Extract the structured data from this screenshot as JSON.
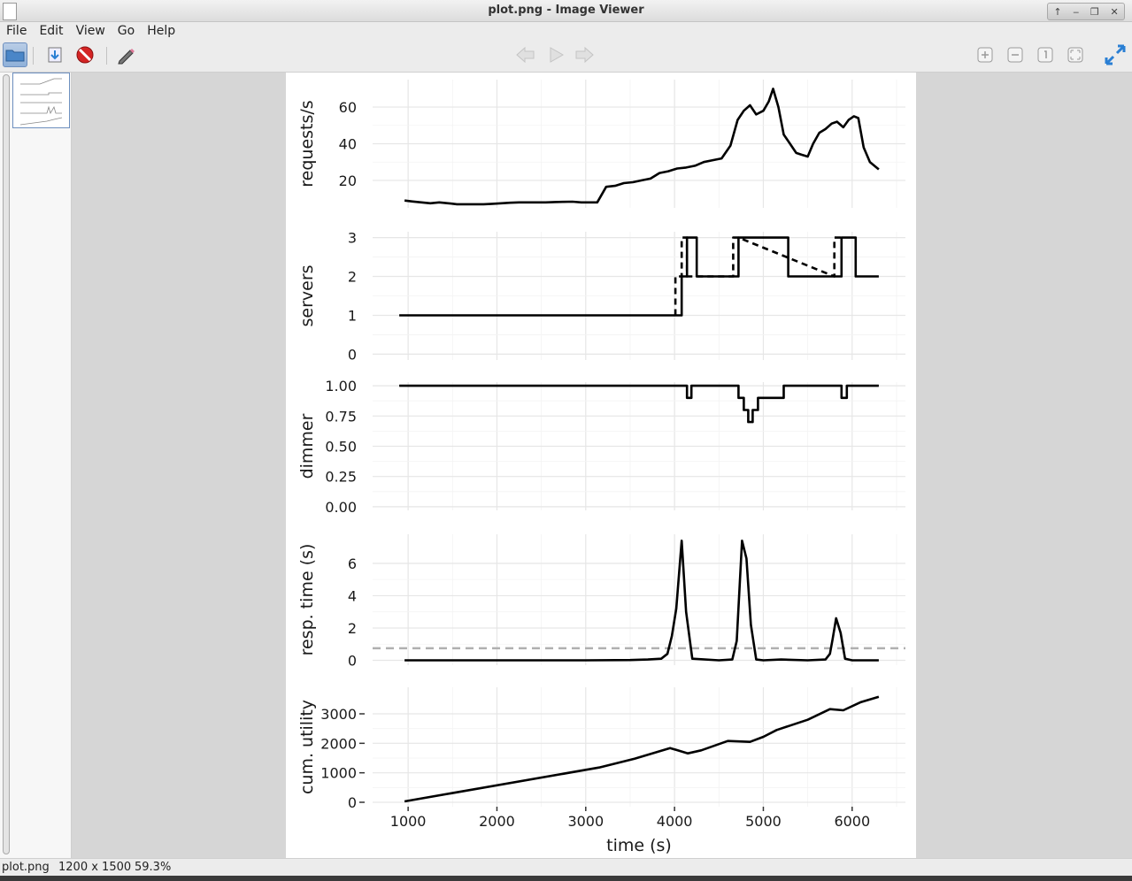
{
  "window": {
    "title": "plot.png - Image Viewer"
  },
  "menu": [
    "File",
    "Edit",
    "View",
    "Go",
    "Help"
  ],
  "status": {
    "filename": "plot.png",
    "dimensions": "1200 x 1500",
    "zoom": "59.3%"
  },
  "chart_data": [
    {
      "type": "line",
      "ylabel": "requests/s",
      "xlim": [
        600,
        6600
      ],
      "ylim": [
        5,
        75
      ],
      "yticks": [
        20,
        40,
        60
      ],
      "yticklabels": [
        "20",
        "40",
        "60"
      ],
      "series": [
        {
          "dash": false,
          "step": false,
          "x": [
            960,
            1050,
            1150,
            1250,
            1350,
            1450,
            1550,
            1650,
            1750,
            1850,
            1950,
            2050,
            2150,
            2250,
            2350,
            2450,
            2550,
            2650,
            2750,
            2850,
            2950,
            3050,
            3130,
            3230,
            3330,
            3430,
            3530,
            3630,
            3730,
            3830,
            3930,
            4030,
            4130,
            4230,
            4330,
            4430,
            4530,
            4630,
            4710,
            4780,
            4850,
            4920,
            5000,
            5060,
            5110,
            5170,
            5230,
            5300,
            5370,
            5430,
            5500,
            5560,
            5630,
            5700,
            5770,
            5830,
            5900,
            5960,
            6020,
            6070,
            6130,
            6200,
            6300
          ],
          "y": [
            9,
            8.5,
            8,
            7.5,
            8,
            7.5,
            7,
            7,
            7,
            7,
            7.2,
            7.5,
            7.8,
            8,
            8,
            8,
            8,
            8.2,
            8.3,
            8.4,
            8,
            8,
            8,
            16.5,
            17,
            18.5,
            19,
            20,
            21,
            24,
            25,
            26.5,
            27,
            28,
            30,
            31,
            32,
            39,
            53,
            58,
            61,
            56,
            58,
            63,
            70,
            60,
            45,
            40,
            35,
            34,
            33,
            40,
            46,
            48,
            51,
            52,
            49,
            53,
            55,
            54,
            38,
            30,
            26
          ]
        }
      ]
    },
    {
      "type": "line",
      "ylabel": "servers",
      "xlim": [
        600,
        6600
      ],
      "ylim": [
        -0.15,
        3.15
      ],
      "yticks": [
        0,
        1,
        2,
        3
      ],
      "yticklabels": [
        "0",
        "1",
        "2",
        "3"
      ],
      "series": [
        {
          "dash": false,
          "step": true,
          "x": [
            900,
            4080,
            4080,
            4140,
            4140,
            4250,
            4250,
            4720,
            4720,
            5280,
            5280,
            5880,
            5880,
            6040,
            6040,
            6300
          ],
          "y": [
            1,
            1,
            2,
            2,
            3,
            3,
            2,
            2,
            3,
            3,
            2,
            2,
            3,
            3,
            2,
            2
          ]
        },
        {
          "dash": true,
          "step": true,
          "x": [
            4010,
            4010,
            4080,
            4080,
            4140,
            4140,
            4250,
            4660,
            4660,
            4720,
            5800,
            5800,
            5880
          ],
          "y": [
            1,
            2,
            2,
            3,
            3,
            2,
            2,
            2,
            3,
            3,
            2,
            3,
            3
          ]
        }
      ]
    },
    {
      "type": "line",
      "ylabel": "dimmer",
      "xlim": [
        600,
        6600
      ],
      "ylim": [
        -0.03,
        1.03
      ],
      "yticks": [
        0,
        0.25,
        0.5,
        0.75,
        1
      ],
      "yticklabels": [
        "0.00",
        "0.25",
        "0.50",
        "0.75",
        "1.00"
      ],
      "series": [
        {
          "dash": false,
          "step": true,
          "x": [
            900,
            4140,
            4140,
            4190,
            4190,
            4720,
            4720,
            4780,
            4780,
            4830,
            4830,
            4880,
            4880,
            4940,
            4940,
            5000,
            5000,
            5230,
            5230,
            5880,
            5880,
            5940,
            5940,
            6300
          ],
          "y": [
            1,
            1,
            0.9,
            0.9,
            1,
            1,
            0.9,
            0.9,
            0.8,
            0.8,
            0.7,
            0.7,
            0.8,
            0.8,
            0.9,
            0.9,
            0.9,
            0.9,
            1,
            1,
            0.9,
            0.9,
            1,
            1
          ]
        }
      ]
    },
    {
      "type": "line",
      "ylabel": "resp. time (s)",
      "xlim": [
        600,
        6600
      ],
      "ylim": [
        -0.3,
        7.8
      ],
      "yticks": [
        0,
        2,
        4,
        6
      ],
      "yticklabels": [
        "0",
        "2",
        "4",
        "6"
      ],
      "reference_line": {
        "y": 0.75,
        "color": "#b0b0b0"
      },
      "series": [
        {
          "dash": false,
          "step": false,
          "x": [
            960,
            1500,
            2000,
            2500,
            3000,
            3500,
            3700,
            3850,
            3920,
            3970,
            4020,
            4080,
            4130,
            4200,
            4500,
            4650,
            4700,
            4760,
            4810,
            4860,
            4920,
            5000,
            5200,
            5500,
            5700,
            5750,
            5780,
            5820,
            5870,
            5920,
            6000,
            6300
          ],
          "y": [
            0,
            0,
            0,
            0,
            0,
            0.02,
            0.05,
            0.1,
            0.4,
            1.5,
            3.2,
            7.4,
            3,
            0.1,
            0,
            0.05,
            1.2,
            7.4,
            6.3,
            2.2,
            0.05,
            0,
            0.05,
            0,
            0.05,
            0.4,
            1.3,
            2.6,
            1.7,
            0.1,
            0,
            0
          ]
        }
      ]
    },
    {
      "type": "line",
      "ylabel": "cum. utility",
      "xlabel": "time (s)",
      "xlim": [
        600,
        6600
      ],
      "ylim": [
        -150,
        3900
      ],
      "yticks": [
        0,
        1000,
        2000,
        3000
      ],
      "yticklabels": [
        "0",
        "1000",
        "2000",
        "3000"
      ],
      "xticks": [
        1000,
        2000,
        3000,
        4000,
        5000,
        6000
      ],
      "xticklabels": [
        "1000",
        "2000",
        "3000",
        "4000",
        "5000",
        "6000"
      ],
      "series": [
        {
          "dash": false,
          "step": false,
          "x": [
            960,
            3150,
            3550,
            3950,
            4150,
            4300,
            4600,
            4850,
            5000,
            5150,
            5300,
            5500,
            5750,
            5900,
            6100,
            6300
          ],
          "y": [
            30,
            1180,
            1480,
            1840,
            1660,
            1760,
            2080,
            2050,
            2220,
            2450,
            2600,
            2800,
            3160,
            3120,
            3400,
            3580
          ]
        }
      ]
    }
  ]
}
